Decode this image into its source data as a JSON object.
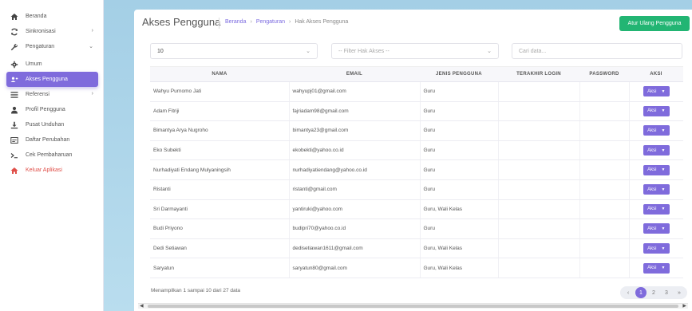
{
  "colors": {
    "accent": "#7f6bdc",
    "success": "#22b573",
    "danger": "#e0504a"
  },
  "sidebar": {
    "items": [
      {
        "label": "Beranda",
        "icon": "home-icon",
        "chevron": "",
        "active": false,
        "danger": false,
        "sub": false
      },
      {
        "label": "Sinkronisasi",
        "icon": "sync-icon",
        "chevron": "›",
        "active": false,
        "danger": false,
        "sub": false
      },
      {
        "label": "Pengaturan",
        "icon": "wrench-icon",
        "chevron": "⌄",
        "active": false,
        "danger": false,
        "sub": false
      },
      {
        "label": "Umum",
        "icon": "gear-icon",
        "chevron": "",
        "active": false,
        "danger": false,
        "sub": true
      },
      {
        "label": "Akses Pengguna",
        "icon": "user-access-icon",
        "chevron": "",
        "active": true,
        "danger": false,
        "sub": true
      },
      {
        "label": "Referensi",
        "icon": "list-icon",
        "chevron": "›",
        "active": false,
        "danger": false,
        "sub": false
      },
      {
        "label": "Profil Pengguna",
        "icon": "user-icon",
        "chevron": "",
        "active": false,
        "danger": false,
        "sub": false
      },
      {
        "label": "Pusat Unduhan",
        "icon": "download-icon",
        "chevron": "",
        "active": false,
        "danger": false,
        "sub": false
      },
      {
        "label": "Daftar Perubahan",
        "icon": "changelog-icon",
        "chevron": "",
        "active": false,
        "danger": false,
        "sub": false
      },
      {
        "label": "Cek Pembaharuan",
        "icon": "terminal-icon",
        "chevron": "",
        "active": false,
        "danger": false,
        "sub": false
      },
      {
        "label": "Keluar Aplikasi",
        "icon": "logout-home-icon",
        "chevron": "",
        "active": false,
        "danger": true,
        "sub": false
      }
    ]
  },
  "header": {
    "title": "Akses Pengguna",
    "breadcrumb": [
      "Beranda",
      "Pengaturan",
      "Hak Akses Pengguna"
    ],
    "reset_button": "Atur Ulang Pengguna"
  },
  "filters": {
    "per_page": "10",
    "role_placeholder": "-- Filter Hak Akses --",
    "search_placeholder": "Cari data..."
  },
  "table": {
    "columns": [
      "NAMA",
      "EMAIL",
      "JENIS PENGGUNA",
      "TERAKHIR LOGIN",
      "PASSWORD",
      "AKSI"
    ],
    "action_label": "Aksi",
    "rows": [
      {
        "nama": "Wahyu Purnomo Jati",
        "email": "wahyupj01@gmail.com",
        "jenis": "Guru",
        "login": "",
        "password": ""
      },
      {
        "nama": "Adam Fitriji",
        "email": "fajriadam98@gmail.com",
        "jenis": "Guru",
        "login": "",
        "password": ""
      },
      {
        "nama": "Bimantya Arya Nugroho",
        "email": "bimantya23@gmail.com",
        "jenis": "Guru",
        "login": "",
        "password": ""
      },
      {
        "nama": "Eko Subekti",
        "email": "ekobekti@yahoo.co.id",
        "jenis": "Guru",
        "login": "",
        "password": ""
      },
      {
        "nama": "Nurhadiyati Endang Mulyaningsih",
        "email": "nurhadiyatiendang@yahoo.co.id",
        "jenis": "Guru",
        "login": "",
        "password": ""
      },
      {
        "nama": "Ristanti",
        "email": "ristanti@gmail.com",
        "jenis": "Guru",
        "login": "",
        "password": ""
      },
      {
        "nama": "Sri Darmayanti",
        "email": "yantiruki@yahoo.com",
        "jenis": "Guru, Wali Kelas",
        "login": "",
        "password": ""
      },
      {
        "nama": "Budi Priyono",
        "email": "budipri70@yahoo.co.id",
        "jenis": "Guru",
        "login": "",
        "password": ""
      },
      {
        "nama": "Dedi Setiawan",
        "email": "dedisetiawan1611@gmail.com",
        "jenis": "Guru, Wali Kelas",
        "login": "",
        "password": ""
      },
      {
        "nama": "Saryatun",
        "email": "saryatun80@gmail.com",
        "jenis": "Guru, Wali Kelas",
        "login": "",
        "password": ""
      }
    ]
  },
  "footer": {
    "info": "Menampilkan 1 sampai 10 dari 27 data",
    "pages": [
      "‹",
      "1",
      "2",
      "3",
      "»"
    ],
    "active_page": "1"
  }
}
